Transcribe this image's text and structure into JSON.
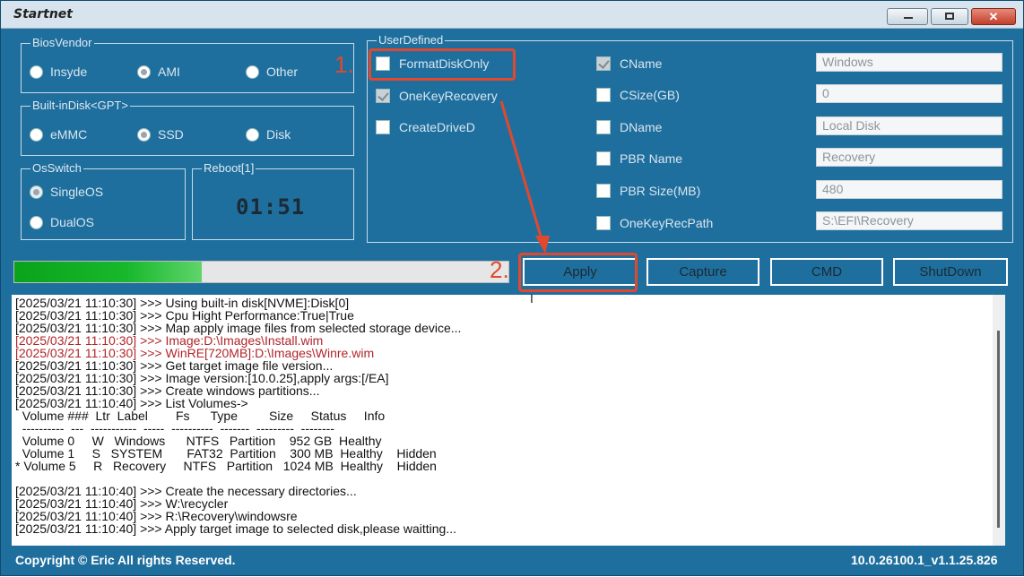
{
  "window": {
    "title": "Startnet",
    "minimize_glyph": "",
    "maximize_glyph": "",
    "close_glyph": "✕"
  },
  "bios_vendor": {
    "legend": "BiosVendor",
    "options": [
      {
        "label": "Insyde",
        "selected": false
      },
      {
        "label": "AMI",
        "selected": true
      },
      {
        "label": "Other",
        "selected": false
      }
    ]
  },
  "builtin_disk": {
    "legend": "Built-inDisk<GPT>",
    "options": [
      {
        "label": "eMMC",
        "selected": false
      },
      {
        "label": "SSD",
        "selected": true
      },
      {
        "label": "Disk",
        "selected": false
      }
    ]
  },
  "os_switch": {
    "legend": "OsSwitch",
    "options": [
      {
        "label": "SingleOS",
        "selected": true
      },
      {
        "label": "DualOS",
        "selected": false
      }
    ]
  },
  "reboot": {
    "legend": "Reboot[1]",
    "timer": "01:51"
  },
  "user_defined": {
    "legend": "UserDefined",
    "checks": [
      {
        "label": "FormatDiskOnly",
        "checked": false
      },
      {
        "label": "OneKeyRecovery",
        "checked": true
      },
      {
        "label": "CreateDriveD",
        "checked": false
      }
    ],
    "fields": [
      {
        "label": "CName",
        "checked": true,
        "value": "Windows"
      },
      {
        "label": "CSize(GB)",
        "checked": false,
        "value": "0"
      },
      {
        "label": "DName",
        "checked": false,
        "value": "Local Disk"
      },
      {
        "label": "PBR Name",
        "checked": false,
        "value": "Recovery"
      },
      {
        "label": "PBR Size(MB)",
        "checked": false,
        "value": "480"
      },
      {
        "label": "OneKeyRecPath",
        "checked": false,
        "value": "S:\\EFI\\Recovery"
      }
    ]
  },
  "progress": {
    "value": 0.38
  },
  "buttons": {
    "apply": "Apply",
    "capture": "Capture",
    "cmd": "CMD",
    "shutdown": "ShutDown"
  },
  "annotations": {
    "step1": "1.",
    "step2": "2."
  },
  "log": [
    {
      "text": "[2025/03/21 11:10:30] >>> Using built-in disk[NVME]:Disk[0]",
      "red": false
    },
    {
      "text": "[2025/03/21 11:10:30] >>> Cpu Hight Performance:True|True",
      "red": false
    },
    {
      "text": "[2025/03/21 11:10:30] >>> Map apply image files from selected storage device...",
      "red": false
    },
    {
      "text": "[2025/03/21 11:10:30] >>> Image:D:\\Images\\Install.wim",
      "red": true
    },
    {
      "text": "[2025/03/21 11:10:30] >>> WinRE[720MB]:D:\\Images\\Winre.wim",
      "red": true
    },
    {
      "text": "[2025/03/21 11:10:30] >>> Get target image file version...",
      "red": false
    },
    {
      "text": "[2025/03/21 11:10:30] >>> Image version:[10.0.25],apply args:[/EA]",
      "red": false
    },
    {
      "text": "[2025/03/21 11:10:30] >>> Create windows partitions...",
      "red": false
    },
    {
      "text": "[2025/03/21 11:10:40] >>> List Volumes->",
      "red": false
    },
    {
      "text": "  Volume ###  Ltr  Label        Fs      Type         Size     Status     Info",
      "red": false
    },
    {
      "text": "  ----------  ---  -----------  -----  ----------  -------  ---------  --------",
      "red": false
    },
    {
      "text": "  Volume 0     W   Windows      NTFS   Partition    952 GB  Healthy",
      "red": false
    },
    {
      "text": "  Volume 1     S   SYSTEM       FAT32  Partition    300 MB  Healthy    Hidden",
      "red": false
    },
    {
      "text": "* Volume 5     R   Recovery     NTFS   Partition   1024 MB  Healthy    Hidden",
      "red": false
    },
    {
      "text": "",
      "red": false
    },
    {
      "text": "[2025/03/21 11:10:40] >>> Create the necessary directories...",
      "red": false
    },
    {
      "text": "[2025/03/21 11:10:40] >>> W:\\recycler",
      "red": false
    },
    {
      "text": "[2025/03/21 11:10:40] >>> R:\\Recovery\\windowsre",
      "red": false
    },
    {
      "text": "[2025/03/21 11:10:40] >>> Apply target image to selected disk,please waitting...",
      "red": false
    }
  ],
  "footer": {
    "copyright": "Copyright © Eric All rights Reserved.",
    "version": "10.0.26100.1_v1.1.25.826"
  }
}
